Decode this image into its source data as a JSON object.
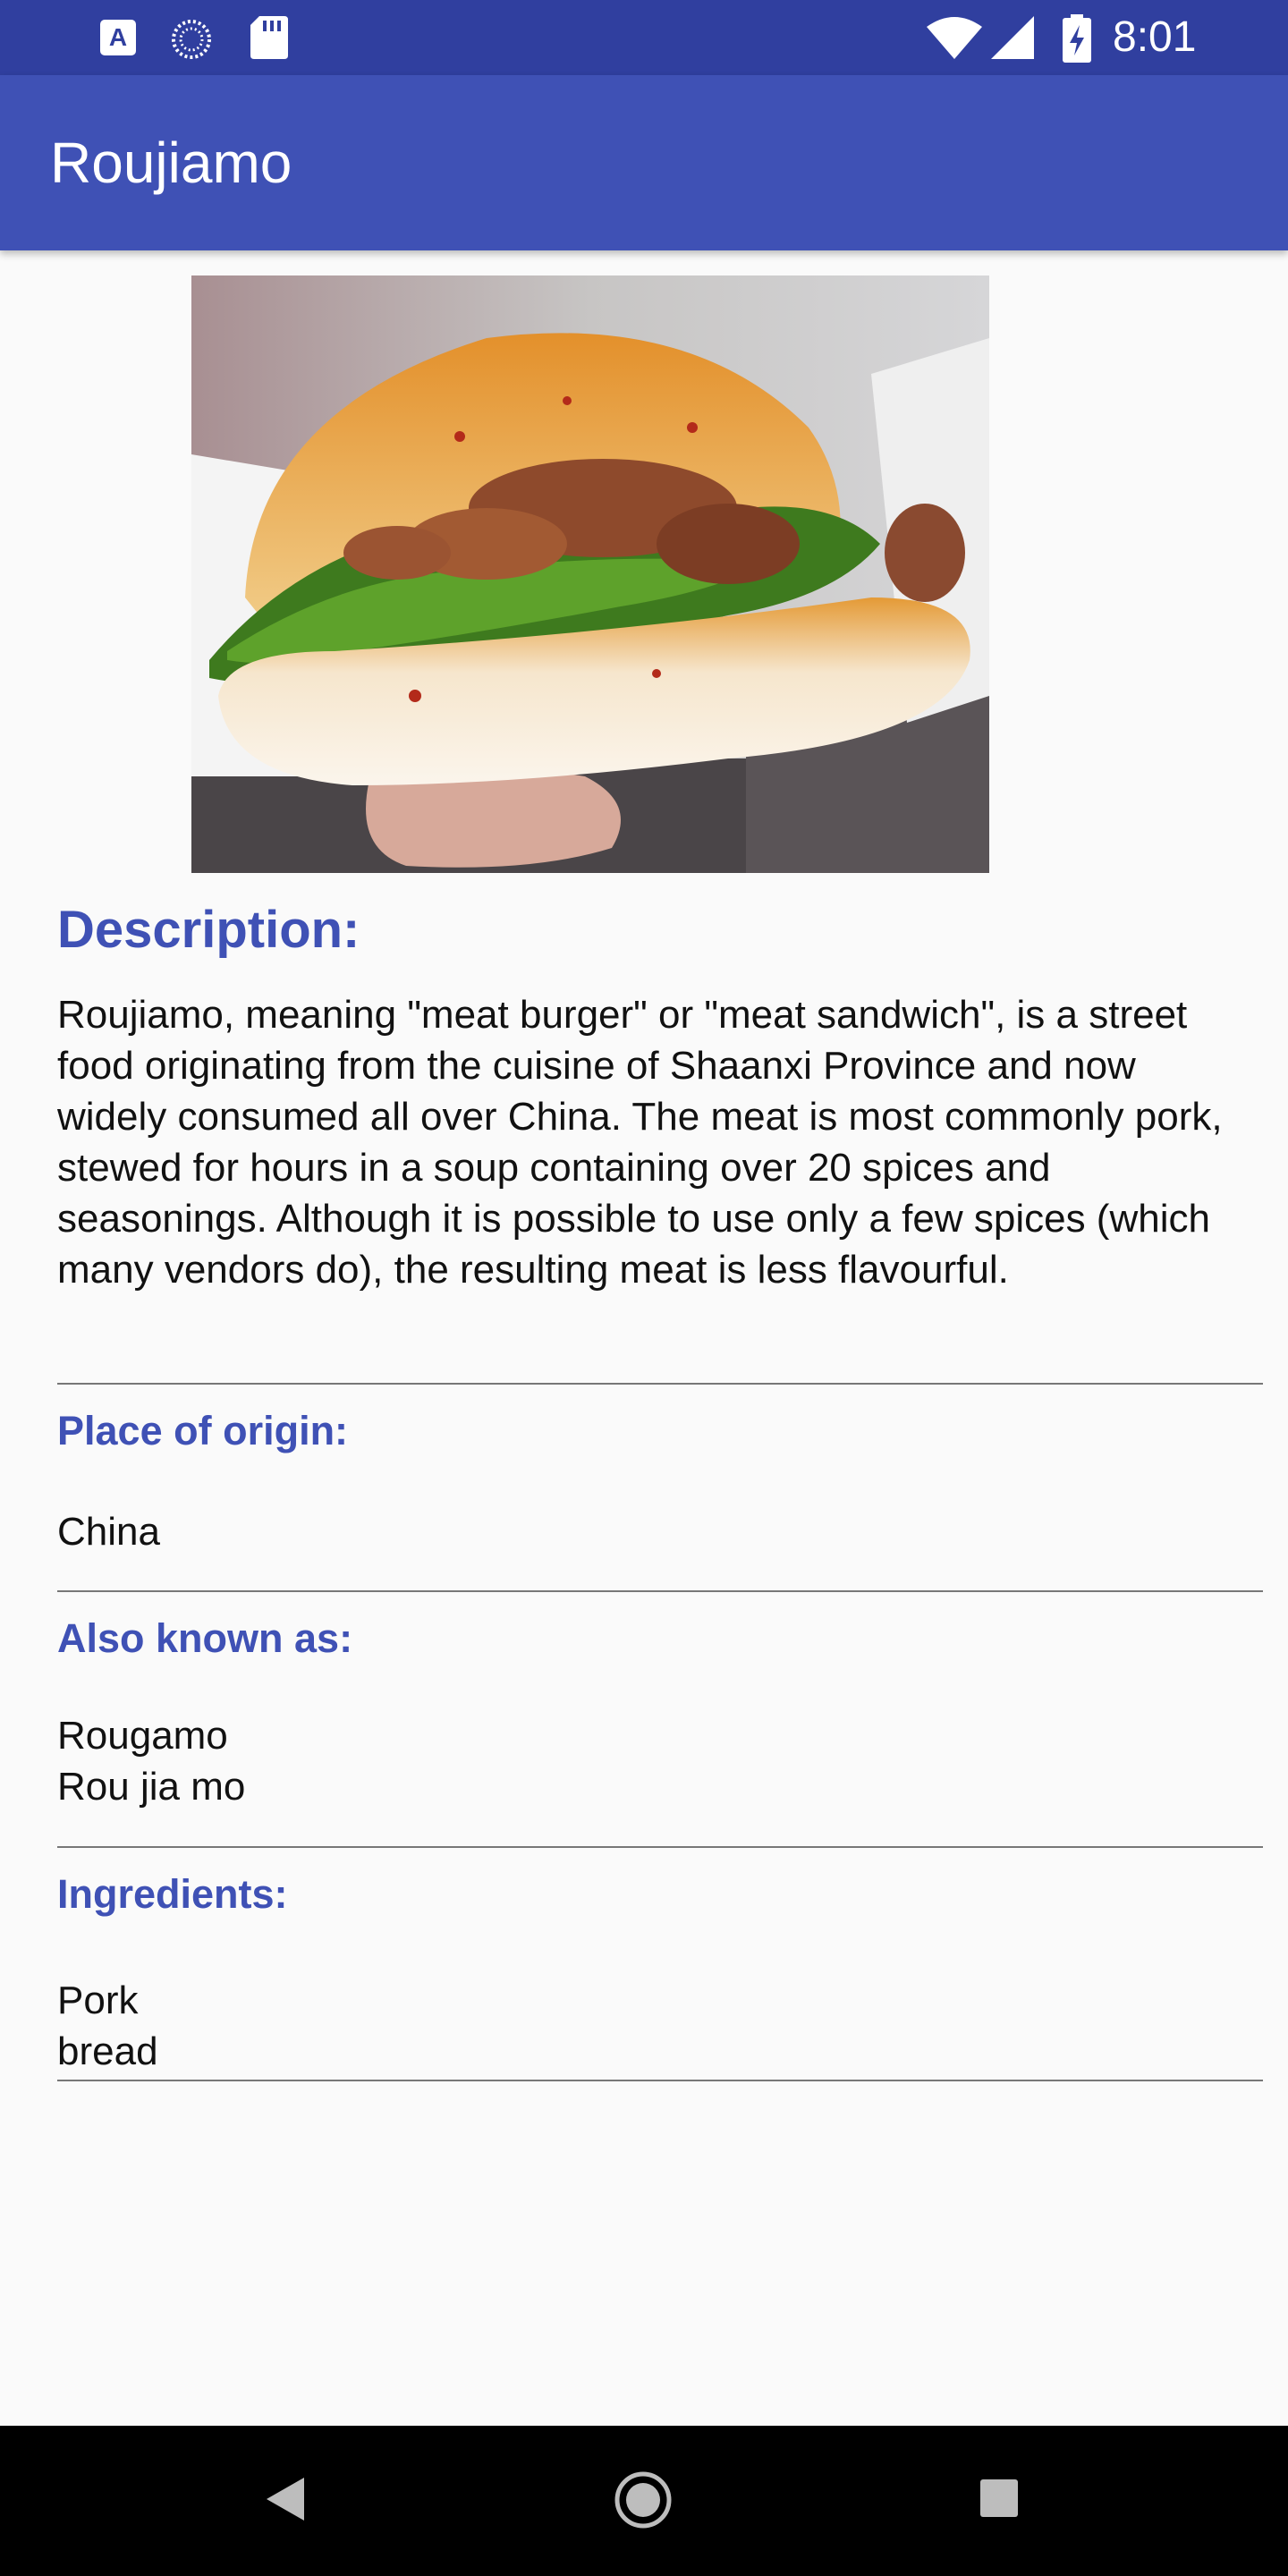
{
  "status_bar": {
    "time": "8:01",
    "left_icons": [
      "a-notification-icon",
      "sync-dots-icon",
      "sd-card-icon"
    ],
    "right_icons": [
      "wifi-icon",
      "signal-icon",
      "battery-charging-icon"
    ]
  },
  "app_bar": {
    "title": "Roujiamo",
    "color": "#3f51b5"
  },
  "hero_image": {
    "subject": "roujiamo sandwich photo"
  },
  "description": {
    "title": "Description:",
    "text": "Roujiamo, meaning \"meat burger\" or \"meat sandwich\", is a street food originating from the cuisine of Shaanxi Province and now widely consumed all over China. The meat is most commonly pork, stewed for hours in a soup containing over 20 spices and seasonings. Although it is possible to use only a few spices (which many vendors do), the resulting meat is less flavourful."
  },
  "place_of_origin": {
    "title": "Place of origin:",
    "value": "China"
  },
  "also_known_as": {
    "title": "Also known as:",
    "values": [
      "Rougamo",
      "Rou jia mo"
    ]
  },
  "ingredients": {
    "title": "Ingredients:",
    "values": [
      "Pork",
      "bread"
    ]
  },
  "nav_bar": {
    "buttons": [
      "back-icon",
      "home-icon",
      "recents-icon"
    ]
  },
  "colors": {
    "status_bar": "#303f9f",
    "accent": "#3f51b5",
    "background": "#fafafa"
  }
}
